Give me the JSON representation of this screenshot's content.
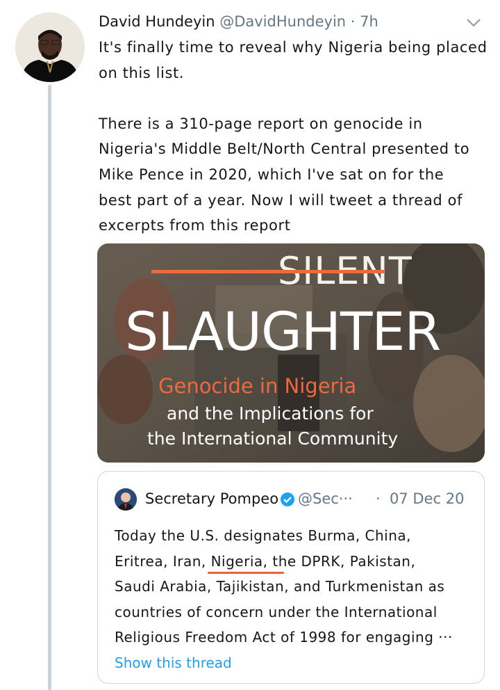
{
  "tweet": {
    "author_name": "David Hundeyin",
    "author_handle": "@DavidHundeyin",
    "separator": "·",
    "time": "7h",
    "text_lines": [
      "It's finally time to reveal why Nigeria being placed",
      "on this list.",
      "",
      "There is a 310-page report on genocide in",
      "Nigeria's Middle Belt/North Central presented to",
      "Mike Pence in 2020, which I've sat on for the",
      "best part of a year. Now I will tweet a thread of",
      "excerpts from this report"
    ],
    "icons": {
      "avatar": "profile-photo",
      "menu": "chevron-down-icon"
    }
  },
  "media": {
    "line1": "SILENT",
    "line2": "SLAUGHTER",
    "line3": "Genocide in Nigeria",
    "line4": "and the Implications for",
    "line5": "the International Community",
    "accent_color": "#ec6a3c"
  },
  "quoted_tweet": {
    "author_name": "Secretary Pompeo",
    "author_handle": "@Sec···",
    "separator": "·",
    "date": "07 Dec 20",
    "text_lines": [
      "Today the U.S. designates Burma, China,",
      "Eritrea, Iran, Nigeria, the DPRK, Pakistan,",
      "Saudi Arabia, Tajikistan, and Turkmenistan as",
      "countries of concern under the International",
      "Religious Freedom Act of 1998 for engaging ···"
    ],
    "show_thread": "Show this thread",
    "link_color": "#1da1f2",
    "icons": {
      "verified": "verified-badge-icon"
    }
  }
}
